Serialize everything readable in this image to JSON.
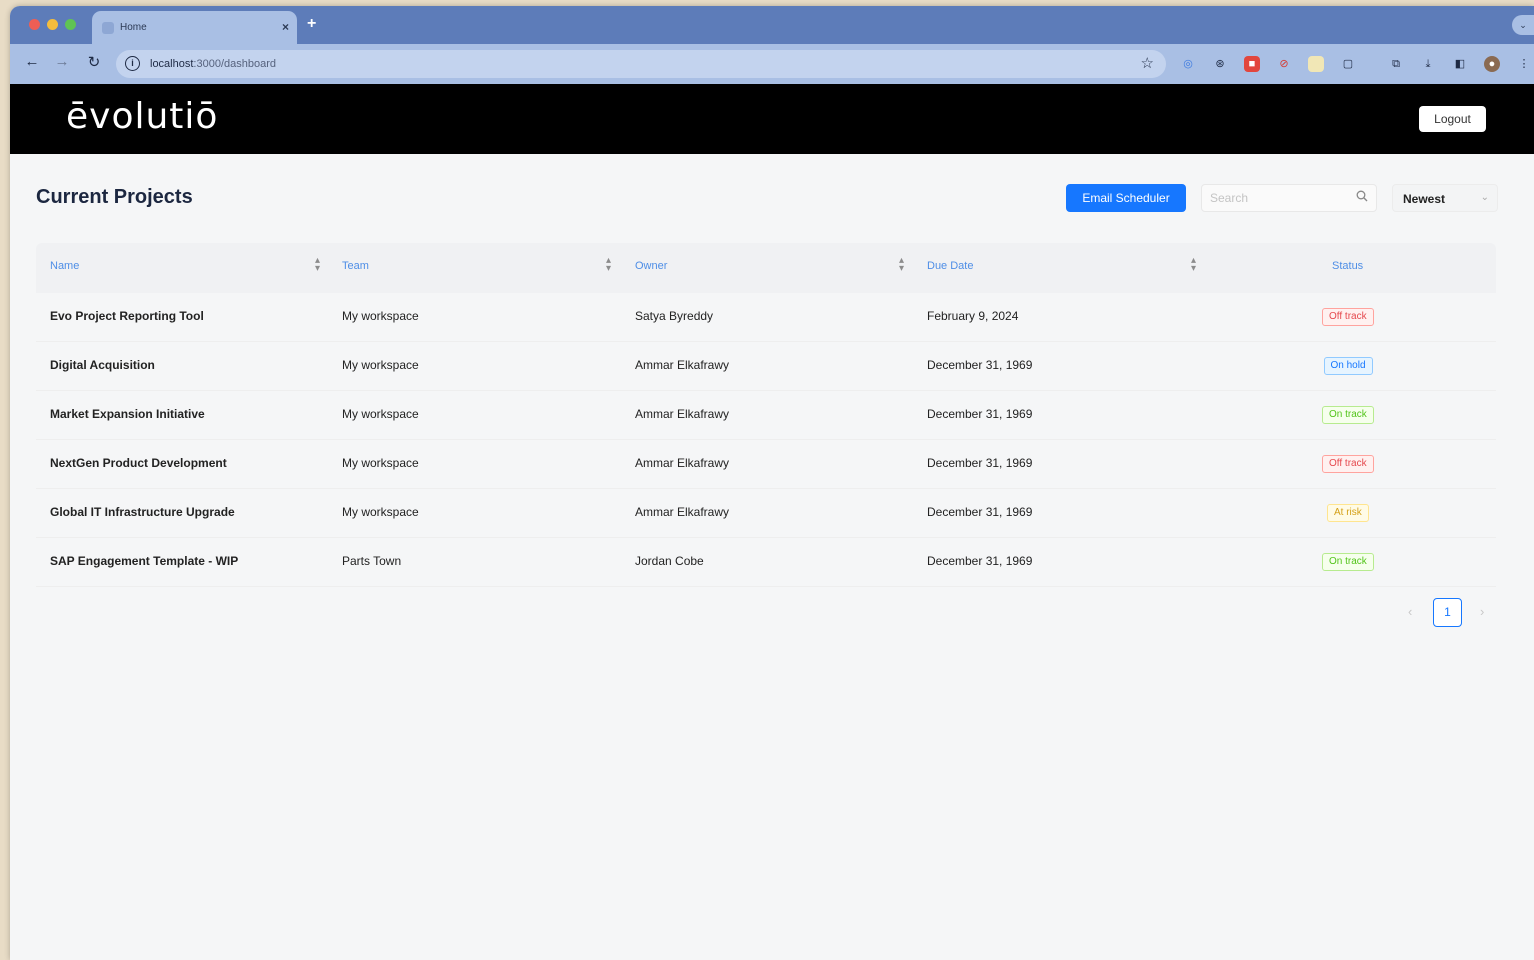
{
  "browser": {
    "tab_title": "Home",
    "tab_close": "×",
    "new_tab": "+",
    "tabs_menu": "⌄",
    "url_host": "localhost",
    "url_path": ":3000/dashboard",
    "nav": {
      "back": "←",
      "forward": "→",
      "reload": "↻"
    },
    "extensions": [
      "translate-icon",
      "extension-icon",
      "pdf-icon",
      "stop-icon",
      "note-icon",
      "puzzle-icon",
      "tabs-icon",
      "download-icon",
      "sidepanel-icon",
      "profile-icon",
      "menu-icon"
    ]
  },
  "header": {
    "logo": "ēvolutiō",
    "logout_label": "Logout"
  },
  "main": {
    "title": "Current Projects",
    "email_button": "Email Scheduler",
    "search_placeholder": "Search",
    "sort_value": "Newest"
  },
  "table": {
    "columns": [
      "Name",
      "Team",
      "Owner",
      "Due Date",
      "Status"
    ],
    "rows": [
      {
        "name": "Evo Project Reporting Tool",
        "team": "My workspace",
        "owner": "Satya Byreddy",
        "due": "February 9, 2024",
        "status": "Off track"
      },
      {
        "name": "Digital Acquisition",
        "team": "My workspace",
        "owner": "Ammar Elkafrawy",
        "due": "December 31, 1969",
        "status": "On hold"
      },
      {
        "name": "Market Expansion Initiative",
        "team": "My workspace",
        "owner": "Ammar Elkafrawy",
        "due": "December 31, 1969",
        "status": "On track"
      },
      {
        "name": "NextGen Product Development",
        "team": "My workspace",
        "owner": "Ammar Elkafrawy",
        "due": "December 31, 1969",
        "status": "Off track"
      },
      {
        "name": "Global IT Infrastructure Upgrade",
        "team": "My workspace",
        "owner": "Ammar Elkafrawy",
        "due": "December 31, 1969",
        "status": "At risk"
      },
      {
        "name": "SAP Engagement Template - WIP",
        "team": "Parts Town",
        "owner": "Jordan Cobe",
        "due": "December 31, 1969",
        "status": "On track"
      }
    ]
  },
  "status_colors": {
    "Off track": {
      "text": "#e5484d",
      "bg": "#fff1f0",
      "border": "#ffa39e"
    },
    "On hold": {
      "text": "#1677ff",
      "bg": "#e6f4ff",
      "border": "#91caff"
    },
    "On track": {
      "text": "#52c41a",
      "bg": "#f6ffed",
      "border": "#b7eb8f"
    },
    "At risk": {
      "text": "#d4a017",
      "bg": "#fffbe6",
      "border": "#ffe58f"
    }
  },
  "pagination": {
    "prev": "‹",
    "current": "1",
    "next": "›"
  }
}
